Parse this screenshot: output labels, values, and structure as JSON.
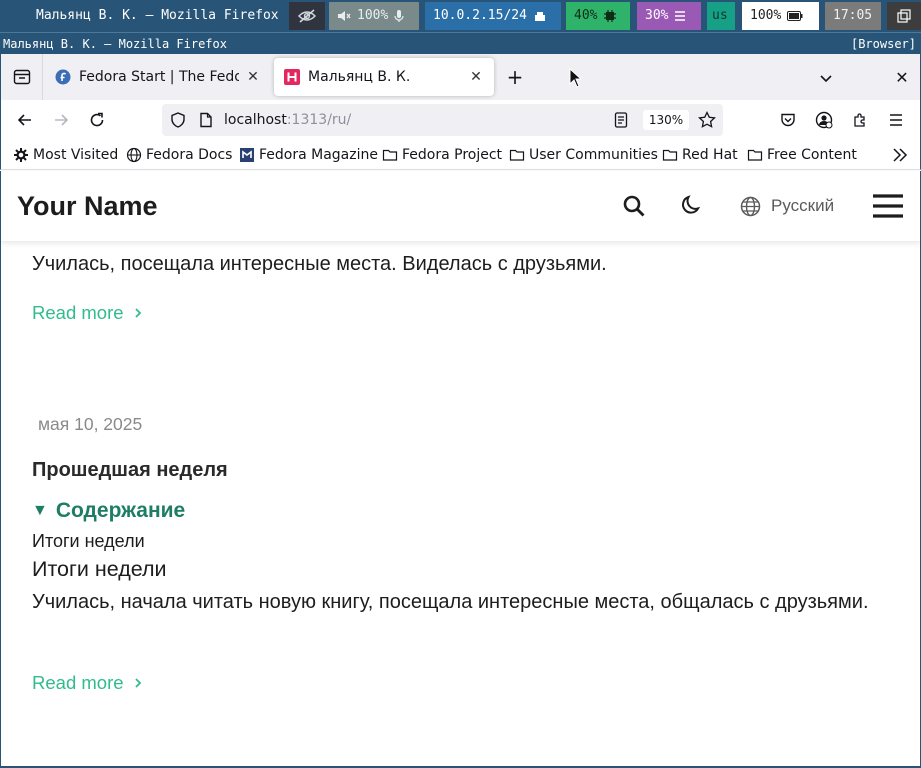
{
  "system_bar": {
    "window_title": "Мальянц В. К. — Mozilla Firefox",
    "volume": "100%",
    "network": "10.0.2.15/24",
    "cpu": "40%",
    "memory": "30%",
    "keyboard_layout": "us",
    "battery": "100%",
    "clock": "17:05"
  },
  "title_bar": {
    "title": "Мальянц В. К. — Mozilla Firefox",
    "mark": "[Browser]"
  },
  "tabs": [
    {
      "label": "Fedora Start | The Fedora Project",
      "close": "✕",
      "active": false
    },
    {
      "label": "Мальянц В. К.",
      "close": "✕",
      "active": true
    }
  ],
  "tab_controls": {
    "new_tab": "+",
    "close_window": "✕"
  },
  "address_bar": {
    "host": "localhost",
    "path": ":1313/ru/",
    "zoom": "130%"
  },
  "bookmarks": [
    {
      "label": "Most Visited",
      "icon": "gear-icon"
    },
    {
      "label": "Fedora Docs",
      "icon": "globe-icon"
    },
    {
      "label": "Fedora Magazine",
      "icon": "fedora-magazine-icon"
    },
    {
      "label": "Fedora Project",
      "icon": "folder-icon"
    },
    {
      "label": "User Communities",
      "icon": "folder-icon"
    },
    {
      "label": "Red Hat",
      "icon": "folder-icon"
    },
    {
      "label": "Free Content",
      "icon": "folder-icon"
    }
  ],
  "site_header": {
    "site_name": "Your Name",
    "language": "Русский"
  },
  "posts": [
    {
      "summary": "Училась, посещала интересные места. Виделась с друзьями.",
      "read_more": "Read more"
    },
    {
      "date": "мая 10, 2025",
      "title": "Прошедшая неделя",
      "toc_label": "Содержание",
      "toc_item": "Итоги недели",
      "heading": "Итоги недели",
      "summary": "Училась, начала читать новую книгу, посещала интересные места, общалась с друзьями.",
      "read_more": "Read more"
    }
  ],
  "colors": {
    "accent_link": "#30bc8c",
    "toc_green": "#1e7e63",
    "wm_blue": "#285577"
  }
}
